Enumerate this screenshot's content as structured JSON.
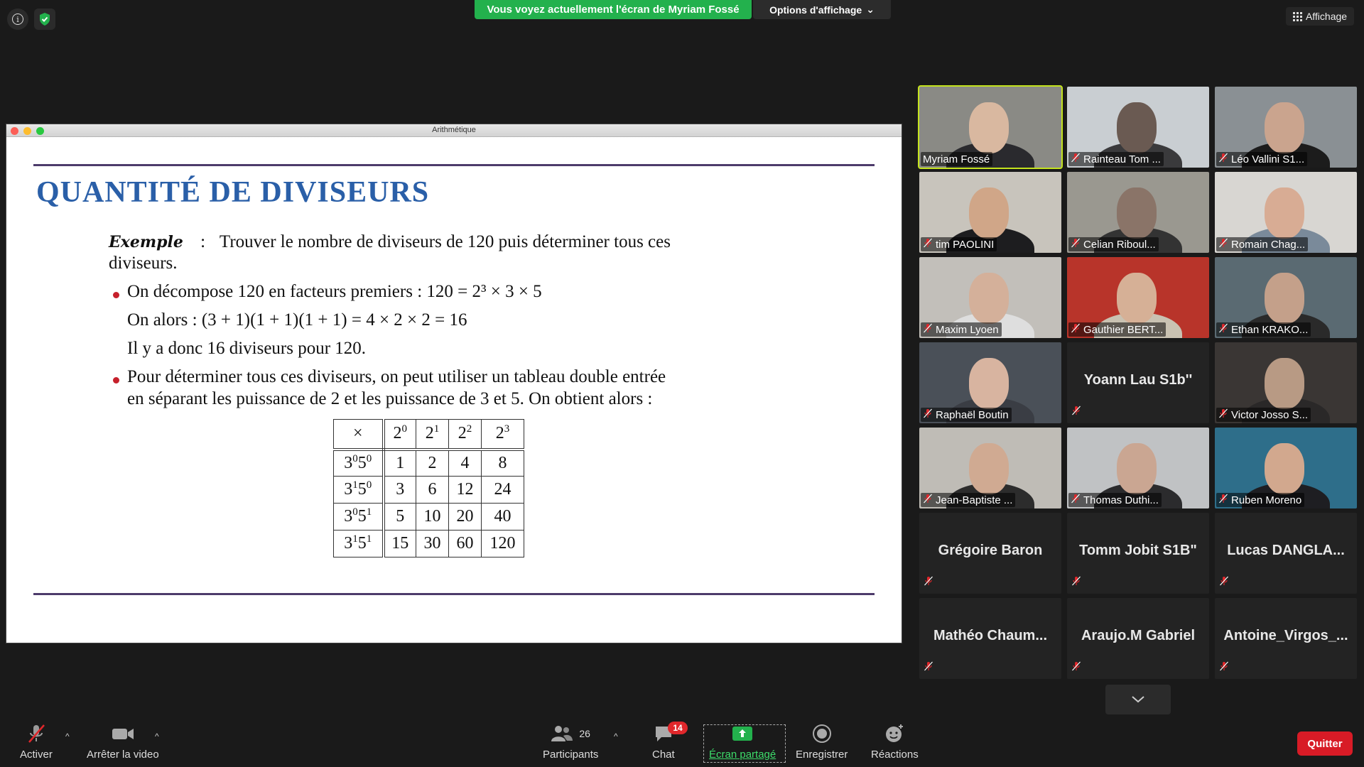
{
  "top": {
    "sharing_banner": "Vous voyez actuellement l'écran de Myriam Fossé",
    "view_options": "Options d'affichage",
    "layout_button": "Affichage"
  },
  "shared_window": {
    "title": "Arithmétique",
    "slide": {
      "title": "QUANTITÉ DE DIVISEURS",
      "exemple_label": "Exemple",
      "exemple_colon": ":",
      "exemple_text_1": "Trouver le nombre de diviseurs de 120 puis déterminer tous ces",
      "exemple_text_2": "diviseurs.",
      "bullet1_line1": "On décompose 120 en facteurs premiers : 120 = 2³ × 3 × 5",
      "bullet1_line2": "On alors : (3 + 1)(1 + 1)(1 + 1) = 4 × 2 × 2 = 16",
      "bullet1_line3": "Il y a donc 16 diviseurs pour 120.",
      "bullet2_line1": "Pour déterminer tous ces diviseurs, on peut utiliser un tableau double entrée",
      "bullet2_line2": "en séparant les puissance de 2 et les puissance de 3 et 5. On obtient alors :",
      "table": {
        "corner": "×",
        "col_headers": [
          {
            "base": "2",
            "exp": "0"
          },
          {
            "base": "2",
            "exp": "1"
          },
          {
            "base": "2",
            "exp": "2"
          },
          {
            "base": "2",
            "exp": "3"
          }
        ],
        "rows": [
          {
            "h": [
              {
                "b": "3",
                "e": "0"
              },
              {
                "b": "5",
                "e": "0"
              }
            ],
            "cells": [
              "1",
              "2",
              "4",
              "8"
            ]
          },
          {
            "h": [
              {
                "b": "3",
                "e": "1"
              },
              {
                "b": "5",
                "e": "0"
              }
            ],
            "cells": [
              "3",
              "6",
              "12",
              "24"
            ]
          },
          {
            "h": [
              {
                "b": "3",
                "e": "0"
              },
              {
                "b": "5",
                "e": "1"
              }
            ],
            "cells": [
              "5",
              "10",
              "20",
              "40"
            ]
          },
          {
            "h": [
              {
                "b": "3",
                "e": "1"
              },
              {
                "b": "5",
                "e": "1"
              }
            ],
            "cells": [
              "15",
              "30",
              "60",
              "120"
            ]
          }
        ]
      }
    }
  },
  "gallery": {
    "participants": [
      {
        "name": "Myriam Fossé",
        "video": true,
        "active": true,
        "muted": false,
        "bg": "#8a8a85",
        "skin": "#d9b8a0",
        "shirt": "#2a2a2e"
      },
      {
        "name": "Rainteau Tom ...",
        "video": true,
        "muted": true,
        "bg": "#c9ced2",
        "skin": "#6a5a52",
        "shirt": "#3a3a3c"
      },
      {
        "name": "Léo Vallini S1...",
        "video": true,
        "muted": true,
        "bg": "#8a9094",
        "skin": "#caa48e",
        "shirt": "#1c1c1c"
      },
      {
        "name": "tim PAOLINI",
        "video": true,
        "muted": true,
        "bg": "#c8c4bc",
        "skin": "#d0a688",
        "shirt": "#1d1d1f"
      },
      {
        "name": "Celian Riboul...",
        "video": true,
        "muted": true,
        "bg": "#9a9890",
        "skin": "#8a7468",
        "shirt": "#333"
      },
      {
        "name": "Romain Chag...",
        "video": true,
        "muted": true,
        "bg": "#d8d6d2",
        "skin": "#d8ac94",
        "shirt": "#7a8a9a"
      },
      {
        "name": "Maxim Lyoen",
        "video": true,
        "muted": true,
        "bg": "#c2bfba",
        "skin": "#d4b09a",
        "shirt": "#dedede"
      },
      {
        "name": "Gauthier BERT...",
        "video": true,
        "muted": true,
        "bg": "#b8342a",
        "skin": "#d6b096",
        "shirt": "#c9c2b2"
      },
      {
        "name": "Ethan KRAKO...",
        "video": true,
        "muted": true,
        "bg": "#5a6a72",
        "skin": "#c4a08a",
        "shirt": "#2a2a2a"
      },
      {
        "name": "Raphaël Boutin",
        "video": true,
        "muted": true,
        "bg": "#4a5058",
        "skin": "#d8b4a0",
        "shirt": "#3a3d44"
      },
      {
        "name": "Yoann Lau S1b''",
        "video": false,
        "muted": true
      },
      {
        "name": "Victor Josso S...",
        "video": true,
        "muted": true,
        "bg": "#3a3634",
        "skin": "#b89a84",
        "shirt": "#2a2828"
      },
      {
        "name": "Jean-Baptiste ...",
        "video": true,
        "muted": true,
        "bg": "#bfbcb6",
        "skin": "#d0aa92",
        "shirt": "#2c2c2c"
      },
      {
        "name": "Thomas Duthi...",
        "video": true,
        "muted": true,
        "bg": "#c0c2c4",
        "skin": "#caa692",
        "shirt": "#2b2b2d"
      },
      {
        "name": "Ruben Moreno",
        "video": true,
        "muted": true,
        "bg": "#2e6e8a",
        "skin": "#d2a88e",
        "shirt": "#1e1e22"
      },
      {
        "name": "Grégoire Baron",
        "video": false,
        "muted": true
      },
      {
        "name": "Tomm Jobit S1B\"",
        "video": false,
        "muted": true
      },
      {
        "name": "Lucas  DANGLA...",
        "video": false,
        "muted": true
      },
      {
        "name": "Mathéo  Chaum...",
        "video": false,
        "muted": true
      },
      {
        "name": "Araujo.M Gabriel",
        "video": false,
        "muted": true
      },
      {
        "name": "Antoine_Virgos_...",
        "video": false,
        "muted": true
      }
    ]
  },
  "toolbar": {
    "mute_label": "Activer",
    "video_label": "Arrêter la video",
    "participants_label": "Participants",
    "participants_count": "26",
    "chat_label": "Chat",
    "chat_badge": "14",
    "share_label": "Écran partagé",
    "record_label": "Enregistrer",
    "reactions_label": "Réactions",
    "quit_label": "Quitter"
  },
  "colors": {
    "banner_green": "#23b14d",
    "active_speaker": "#c4e31d",
    "slide_title_blue": "#2a5fa8",
    "bullet_red": "#c6202b",
    "quit_red": "#d81b26"
  }
}
